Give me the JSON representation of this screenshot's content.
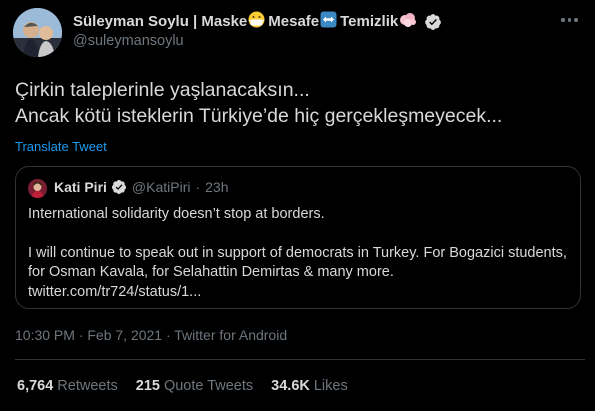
{
  "author": {
    "name": "Süleyman Soylu | Maske",
    "name_seg2": "Mesafe",
    "name_seg3": "Temizlik",
    "handle": "@suleymansoylu"
  },
  "tweet": {
    "text": "Çirkin taleplerinle yaşlanacaksın...\nAncak kötü isteklerin Türkiye’de hiç gerçekleşmeyecek...",
    "translate_label": "Translate Tweet"
  },
  "quoted": {
    "name": "Kati Piri",
    "handle": "@KatiPiri",
    "separator": "·",
    "time": "23h",
    "line1": "International solidarity doesn’t stop at borders.",
    "line2": "I will continue to speak out in support of democrats in Turkey. For Bogazici students, for Osman Kavala, for Selahattin Demirtas & many more.",
    "line3": "twitter.com/tr724/status/1..."
  },
  "meta": {
    "text": "10:30 PM · Feb 7, 2021 · Twitter for Android"
  },
  "stats": {
    "retweets_count": "6,764",
    "retweets_label": "Retweets",
    "quotes_count": "215",
    "quotes_label": "Quote Tweets",
    "likes_count": "34.6K",
    "likes_label": "Likes"
  },
  "colors": {
    "background": "#000000",
    "text": "#d9d9d9",
    "muted": "#6e767d",
    "link": "#1d9bf0",
    "border": "#2f3336"
  },
  "icons": [
    "mask-emoji-icon",
    "left-right-arrow-emoji-icon",
    "sponge-emoji-icon",
    "verified-badge-icon",
    "more-options-icon"
  ]
}
